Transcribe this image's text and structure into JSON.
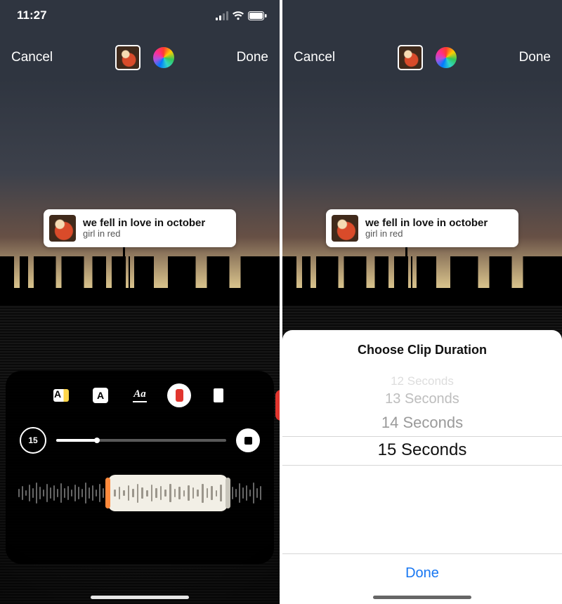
{
  "status": {
    "time": "11:27"
  },
  "toolbar": {
    "cancel": "Cancel",
    "done": "Done"
  },
  "song": {
    "title": "we fell in love in october",
    "artist": "girl in red"
  },
  "editor": {
    "duration_value": "15",
    "progress_pct": 24
  },
  "sheet": {
    "title": "Choose Clip Duration",
    "options": {
      "o12": "12 Seconds",
      "o13": "13 Seconds",
      "o14": "14 Seconds",
      "o15": "15 Seconds"
    },
    "done": "Done"
  }
}
